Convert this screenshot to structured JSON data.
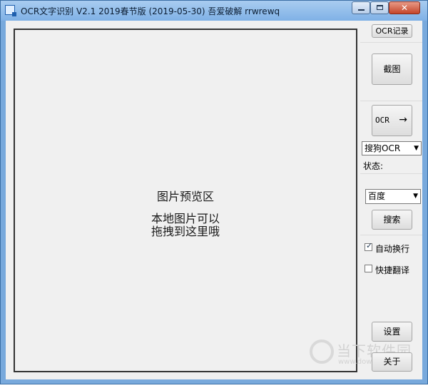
{
  "window": {
    "title": "OCR文字识别 V2.1   2019春节版 (2019-05-30)   吾爱破解 rrwrewq",
    "close_glyph": "✕"
  },
  "preview": {
    "title": "图片预览区",
    "hint_line1": "本地图片可以",
    "hint_line2": "拖拽到这里哦"
  },
  "buttons": {
    "ocr_log": "OCR记录",
    "screenshot": "截图",
    "ocr": "OCR",
    "ocr_arrow": "→",
    "search": "搜索",
    "settings": "设置",
    "about": "关于"
  },
  "engine": {
    "selected": "搜狗OCR"
  },
  "status": {
    "label": "状态:"
  },
  "search_engine": {
    "selected": "百度"
  },
  "options": {
    "auto_wrap": {
      "label": "自动换行",
      "checked": true
    },
    "quick_translate": {
      "label": "快捷翻译",
      "checked": false
    }
  },
  "watermark": {
    "text": "当下软件园",
    "url": "www.downxia.com"
  },
  "icons": {
    "app": "app-icon",
    "dropdown": "chevron-down-icon",
    "check": "check-icon"
  },
  "colors": {
    "title_bar": "#a9ccf0",
    "close_button": "#c4452a",
    "client_bg": "#f0f0f0"
  }
}
